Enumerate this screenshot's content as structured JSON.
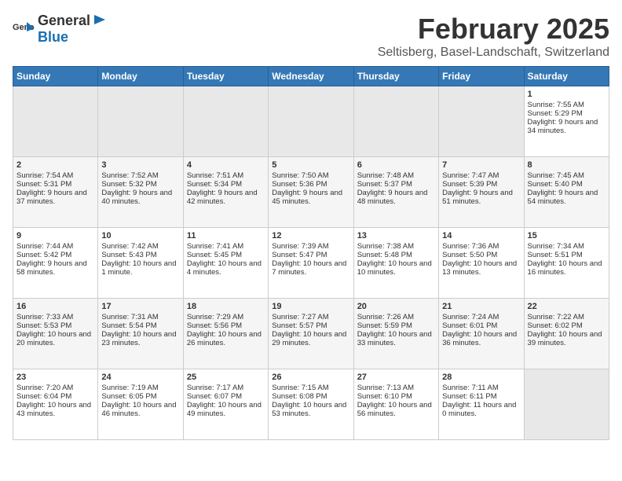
{
  "header": {
    "logo_general": "General",
    "logo_blue": "Blue",
    "title": "February 2025",
    "subtitle": "Seltisberg, Basel-Landschaft, Switzerland"
  },
  "weekdays": [
    "Sunday",
    "Monday",
    "Tuesday",
    "Wednesday",
    "Thursday",
    "Friday",
    "Saturday"
  ],
  "weeks": [
    [
      {
        "day": "",
        "text": "",
        "empty": true
      },
      {
        "day": "",
        "text": "",
        "empty": true
      },
      {
        "day": "",
        "text": "",
        "empty": true
      },
      {
        "day": "",
        "text": "",
        "empty": true
      },
      {
        "day": "",
        "text": "",
        "empty": true
      },
      {
        "day": "",
        "text": "",
        "empty": true
      },
      {
        "day": "1",
        "text": "Sunrise: 7:55 AM\nSunset: 5:29 PM\nDaylight: 9 hours and 34 minutes.",
        "empty": false
      }
    ],
    [
      {
        "day": "2",
        "text": "Sunrise: 7:54 AM\nSunset: 5:31 PM\nDaylight: 9 hours and 37 minutes.",
        "empty": false
      },
      {
        "day": "3",
        "text": "Sunrise: 7:52 AM\nSunset: 5:32 PM\nDaylight: 9 hours and 40 minutes.",
        "empty": false
      },
      {
        "day": "4",
        "text": "Sunrise: 7:51 AM\nSunset: 5:34 PM\nDaylight: 9 hours and 42 minutes.",
        "empty": false
      },
      {
        "day": "5",
        "text": "Sunrise: 7:50 AM\nSunset: 5:36 PM\nDaylight: 9 hours and 45 minutes.",
        "empty": false
      },
      {
        "day": "6",
        "text": "Sunrise: 7:48 AM\nSunset: 5:37 PM\nDaylight: 9 hours and 48 minutes.",
        "empty": false
      },
      {
        "day": "7",
        "text": "Sunrise: 7:47 AM\nSunset: 5:39 PM\nDaylight: 9 hours and 51 minutes.",
        "empty": false
      },
      {
        "day": "8",
        "text": "Sunrise: 7:45 AM\nSunset: 5:40 PM\nDaylight: 9 hours and 54 minutes.",
        "empty": false
      }
    ],
    [
      {
        "day": "9",
        "text": "Sunrise: 7:44 AM\nSunset: 5:42 PM\nDaylight: 9 hours and 58 minutes.",
        "empty": false
      },
      {
        "day": "10",
        "text": "Sunrise: 7:42 AM\nSunset: 5:43 PM\nDaylight: 10 hours and 1 minute.",
        "empty": false
      },
      {
        "day": "11",
        "text": "Sunrise: 7:41 AM\nSunset: 5:45 PM\nDaylight: 10 hours and 4 minutes.",
        "empty": false
      },
      {
        "day": "12",
        "text": "Sunrise: 7:39 AM\nSunset: 5:47 PM\nDaylight: 10 hours and 7 minutes.",
        "empty": false
      },
      {
        "day": "13",
        "text": "Sunrise: 7:38 AM\nSunset: 5:48 PM\nDaylight: 10 hours and 10 minutes.",
        "empty": false
      },
      {
        "day": "14",
        "text": "Sunrise: 7:36 AM\nSunset: 5:50 PM\nDaylight: 10 hours and 13 minutes.",
        "empty": false
      },
      {
        "day": "15",
        "text": "Sunrise: 7:34 AM\nSunset: 5:51 PM\nDaylight: 10 hours and 16 minutes.",
        "empty": false
      }
    ],
    [
      {
        "day": "16",
        "text": "Sunrise: 7:33 AM\nSunset: 5:53 PM\nDaylight: 10 hours and 20 minutes.",
        "empty": false
      },
      {
        "day": "17",
        "text": "Sunrise: 7:31 AM\nSunset: 5:54 PM\nDaylight: 10 hours and 23 minutes.",
        "empty": false
      },
      {
        "day": "18",
        "text": "Sunrise: 7:29 AM\nSunset: 5:56 PM\nDaylight: 10 hours and 26 minutes.",
        "empty": false
      },
      {
        "day": "19",
        "text": "Sunrise: 7:27 AM\nSunset: 5:57 PM\nDaylight: 10 hours and 29 minutes.",
        "empty": false
      },
      {
        "day": "20",
        "text": "Sunrise: 7:26 AM\nSunset: 5:59 PM\nDaylight: 10 hours and 33 minutes.",
        "empty": false
      },
      {
        "day": "21",
        "text": "Sunrise: 7:24 AM\nSunset: 6:01 PM\nDaylight: 10 hours and 36 minutes.",
        "empty": false
      },
      {
        "day": "22",
        "text": "Sunrise: 7:22 AM\nSunset: 6:02 PM\nDaylight: 10 hours and 39 minutes.",
        "empty": false
      }
    ],
    [
      {
        "day": "23",
        "text": "Sunrise: 7:20 AM\nSunset: 6:04 PM\nDaylight: 10 hours and 43 minutes.",
        "empty": false
      },
      {
        "day": "24",
        "text": "Sunrise: 7:19 AM\nSunset: 6:05 PM\nDaylight: 10 hours and 46 minutes.",
        "empty": false
      },
      {
        "day": "25",
        "text": "Sunrise: 7:17 AM\nSunset: 6:07 PM\nDaylight: 10 hours and 49 minutes.",
        "empty": false
      },
      {
        "day": "26",
        "text": "Sunrise: 7:15 AM\nSunset: 6:08 PM\nDaylight: 10 hours and 53 minutes.",
        "empty": false
      },
      {
        "day": "27",
        "text": "Sunrise: 7:13 AM\nSunset: 6:10 PM\nDaylight: 10 hours and 56 minutes.",
        "empty": false
      },
      {
        "day": "28",
        "text": "Sunrise: 7:11 AM\nSunset: 6:11 PM\nDaylight: 11 hours and 0 minutes.",
        "empty": false
      },
      {
        "day": "",
        "text": "",
        "empty": true
      }
    ]
  ]
}
